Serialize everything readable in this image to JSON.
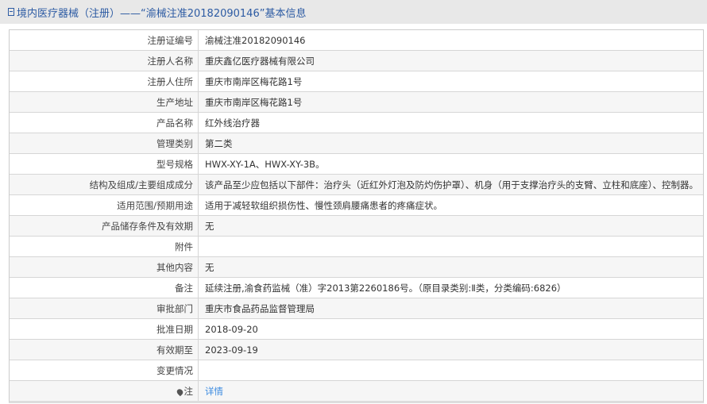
{
  "header": {
    "title": "境内医疗器械（注册）——“渝械注准20182090146”基本信息",
    "icon": "document-icon"
  },
  "rows": [
    {
      "label": "注册证编号",
      "value": "渝械注准20182090146"
    },
    {
      "label": "注册人名称",
      "value": "重庆鑫亿医疗器械有限公司"
    },
    {
      "label": "注册人住所",
      "value": "重庆市南岸区梅花路1号"
    },
    {
      "label": "生产地址",
      "value": "重庆市南岸区梅花路1号"
    },
    {
      "label": "产品名称",
      "value": "红外线治疗器"
    },
    {
      "label": "管理类别",
      "value": "第二类"
    },
    {
      "label": "型号规格",
      "value": "HWX-XY-1A、HWX-XY-3B。"
    },
    {
      "label": "结构及组成/主要组成成分",
      "value": "该产品至少应包括以下部件：治疗头（近红外灯泡及防灼伤护罩）、机身（用于支撑治疗头的支臂、立柱和底座）、控制器。"
    },
    {
      "label": "适用范围/预期用途",
      "value": "适用于减轻软组织损伤性、慢性颈肩腰痛患者的疼痛症状。"
    },
    {
      "label": "产品储存条件及有效期",
      "value": "无"
    },
    {
      "label": "附件",
      "value": ""
    },
    {
      "label": "其他内容",
      "value": "无"
    },
    {
      "label": "备注",
      "value": "延续注册,渝食药监械（准）字2013第2260186号。（原目录类别:Ⅱ类，分类编码:6826）"
    },
    {
      "label": "审批部门",
      "value": "重庆市食品药品监督管理局"
    },
    {
      "label": "批准日期",
      "value": "2018-09-20"
    },
    {
      "label": "有效期至",
      "value": "2023-09-19"
    },
    {
      "label": "变更情况",
      "value": ""
    }
  ],
  "note_row": {
    "label": "注",
    "icon": "pin-icon",
    "link": "详情"
  }
}
